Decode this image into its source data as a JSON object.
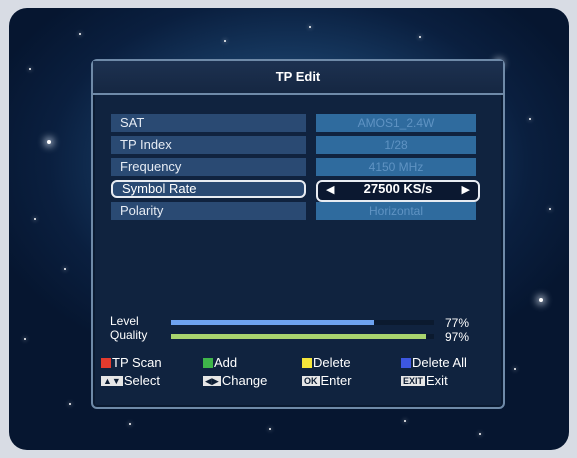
{
  "dialog": {
    "title": "TP Edit"
  },
  "settings": [
    {
      "label": "SAT",
      "value": "AMOS1_2.4W"
    },
    {
      "label": "TP Index",
      "value": "1/28"
    },
    {
      "label": "Frequency",
      "value": "4150 MHz"
    },
    {
      "label": "Symbol Rate",
      "value": "27500 KS/s",
      "selected": true
    },
    {
      "label": "Polarity",
      "value": "Horizontal"
    }
  ],
  "signal": {
    "level": {
      "label": "Level",
      "percent_text": "77%",
      "value": 77,
      "color": "#6ea3f0"
    },
    "quality": {
      "label": "Quality",
      "percent_text": "97%",
      "value": 97,
      "color": "#a8d46e"
    }
  },
  "legend": {
    "tp_scan": {
      "label": "TP Scan",
      "color": "#e23b2e"
    },
    "add": {
      "label": "Add",
      "color": "#3fb54a"
    },
    "delete": {
      "label": "Delete",
      "color": "#f4e53a"
    },
    "delete_all": {
      "label": "Delete All",
      "color": "#3d57e0"
    },
    "select": {
      "key": "▲▼",
      "label": "Select"
    },
    "change": {
      "key": "◀▶",
      "label": "Change"
    },
    "enter": {
      "key": "OK",
      "label": "Enter"
    },
    "exit": {
      "key": "EXIT",
      "label": "Exit"
    }
  }
}
